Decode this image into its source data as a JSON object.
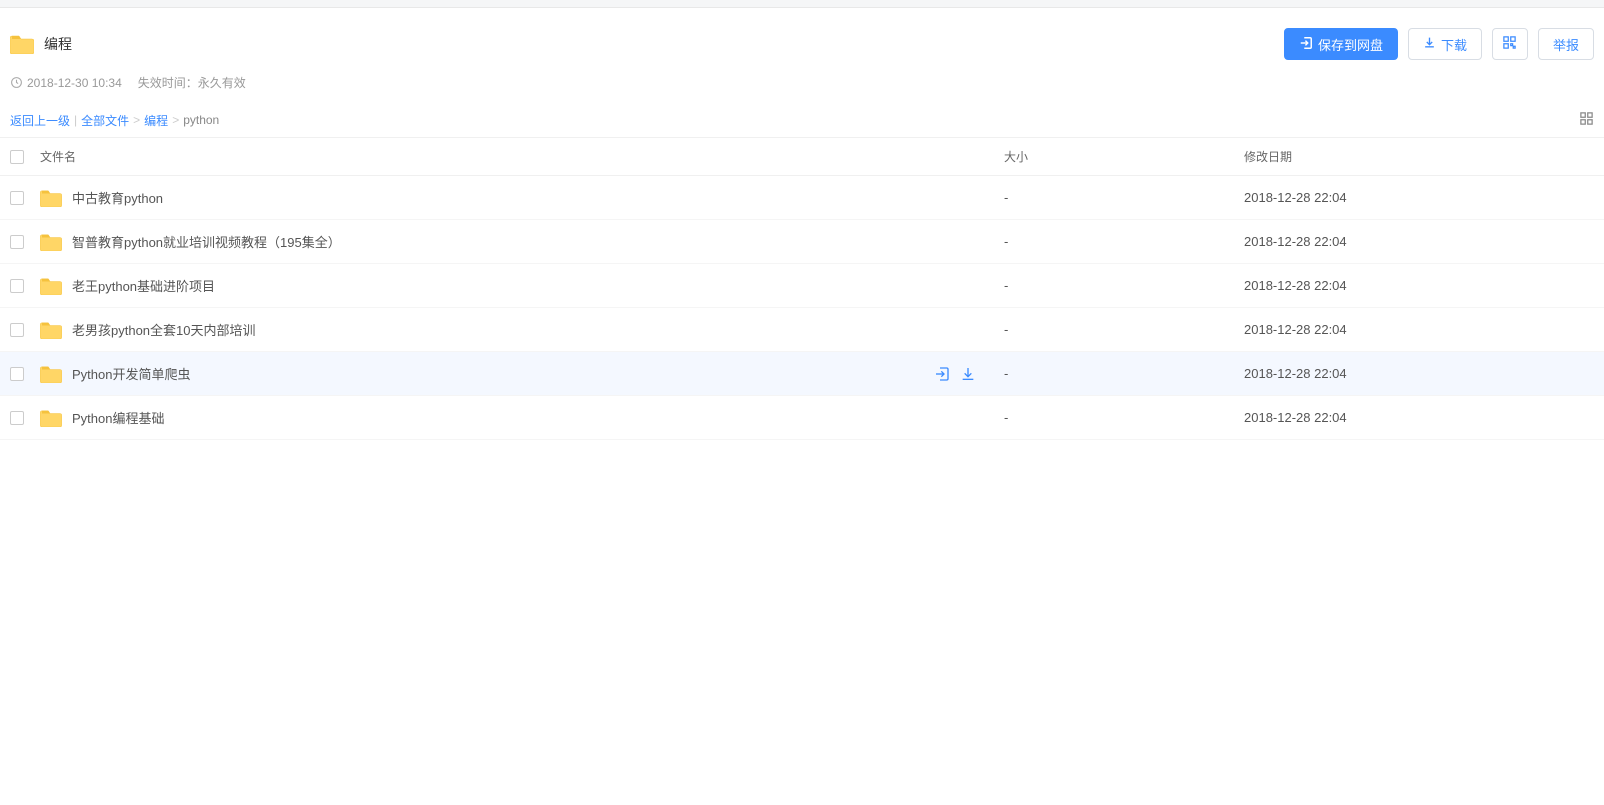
{
  "header": {
    "folder_title": "编程",
    "save_button": "保存到网盘",
    "download_button": "下载",
    "report_button": "举报"
  },
  "meta": {
    "timestamp": "2018-12-30 10:34",
    "expiry_label": "失效时间：永久有效"
  },
  "breadcrumb": {
    "back": "返回上一级",
    "all_files": "全部文件",
    "parent": "编程",
    "current": "python"
  },
  "columns": {
    "name": "文件名",
    "size": "大小",
    "date": "修改日期"
  },
  "files": [
    {
      "name": "中古教育python",
      "size": "-",
      "date": "2018-12-28 22:04",
      "hover": false
    },
    {
      "name": "智普教育python就业培训视频教程（195集全）",
      "size": "-",
      "date": "2018-12-28 22:04",
      "hover": false
    },
    {
      "name": "老王python基础进阶项目",
      "size": "-",
      "date": "2018-12-28 22:04",
      "hover": false
    },
    {
      "name": "老男孩python全套10天内部培训",
      "size": "-",
      "date": "2018-12-28 22:04",
      "hover": false
    },
    {
      "name": "Python开发简单爬虫",
      "size": "-",
      "date": "2018-12-28 22:04",
      "hover": true
    },
    {
      "name": "Python编程基础",
      "size": "-",
      "date": "2018-12-28 22:04",
      "hover": false
    }
  ]
}
